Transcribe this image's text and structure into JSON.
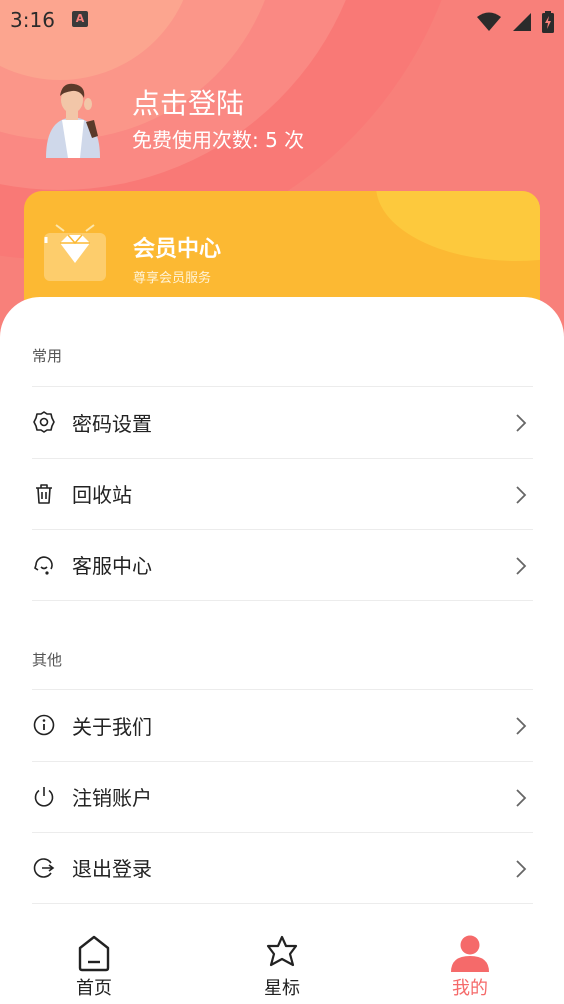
{
  "status_bar": {
    "time": "3:16",
    "notification_badge": "A",
    "icons": [
      "wifi-icon",
      "signal-icon",
      "battery-charging-icon"
    ]
  },
  "profile": {
    "login_text": "点击登陆",
    "free_uses_text": "免费使用次数: 5 次"
  },
  "vip_card": {
    "title": "会员中心",
    "subtitle": "尊享会员服务",
    "icon": "diamond-icon"
  },
  "sections": {
    "common": {
      "title": "常用",
      "items": [
        {
          "label": "密码设置",
          "icon": "gear-icon"
        },
        {
          "label": "回收站",
          "icon": "trash-icon"
        },
        {
          "label": "客服中心",
          "icon": "customer-service-icon"
        }
      ]
    },
    "other": {
      "title": "其他",
      "items": [
        {
          "label": "关于我们",
          "icon": "info-icon"
        },
        {
          "label": "注销账户",
          "icon": "power-icon"
        },
        {
          "label": "退出登录",
          "icon": "logout-icon"
        }
      ]
    }
  },
  "tabbar": {
    "items": [
      {
        "label": "首页",
        "icon": "home-icon"
      },
      {
        "label": "星标",
        "icon": "star-icon"
      },
      {
        "label": "我的",
        "icon": "user-icon",
        "active": true
      }
    ]
  },
  "colors": {
    "header": "#f8807a",
    "vip_card": "#fcb933",
    "active_tab": "#f56a6a"
  }
}
